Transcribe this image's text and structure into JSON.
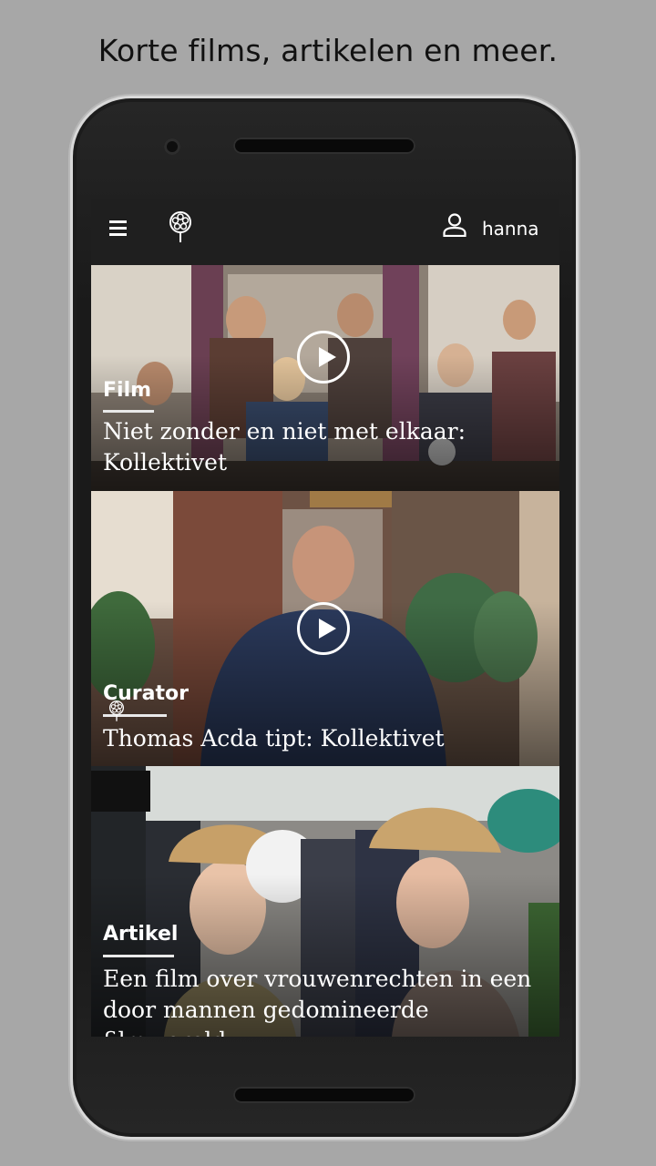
{
  "headline": "Korte films, artikelen en meer.",
  "appbar": {
    "menu_icon": "hamburger-menu-icon",
    "logo_icon": "film-reel-tree-logo",
    "user_icon": "person-icon",
    "username": "hanna"
  },
  "cards": [
    {
      "category": "Film",
      "title": "Niet zonder en niet met elkaar: Kollektivet",
      "has_play": true,
      "accent": "#6b4a3c"
    },
    {
      "category": "Curator",
      "title": "Thomas Acda tipt: Kollektivet",
      "has_play": true,
      "accent": "#2f3a52"
    },
    {
      "category": "Artikel",
      "title": "Een film over vrouwenrechten in een door mannen gedomineerde filmwereld",
      "has_play": false,
      "accent": "#c9a775"
    }
  ]
}
